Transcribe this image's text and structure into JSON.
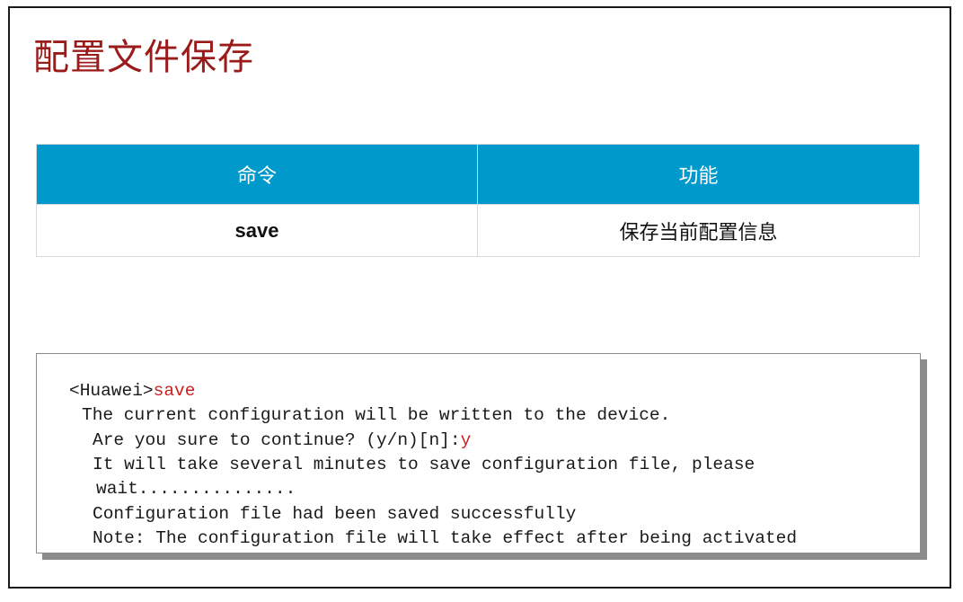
{
  "slide": {
    "title": "配置文件保存"
  },
  "table": {
    "headers": [
      "命令",
      "功能"
    ],
    "rows": [
      {
        "command": "save",
        "function": "保存当前配置信息"
      }
    ]
  },
  "terminal": {
    "prompt": "<Huawei>",
    "command": "save",
    "line2": "The current configuration will be written to the device.",
    "line3_prefix": "Are you sure to continue? (y/n)[n]:",
    "line3_answer": "y",
    "line4": "It will take several minutes to save configuration file, please",
    "line5": "wait...............",
    "line6": "Configuration file had been saved successfully",
    "line7": "Note: The configuration file will take effect after being activated"
  },
  "colors": {
    "title": "#9b1b1b",
    "table_header_bg": "#0099cc",
    "highlight": "#cc1f1f"
  }
}
